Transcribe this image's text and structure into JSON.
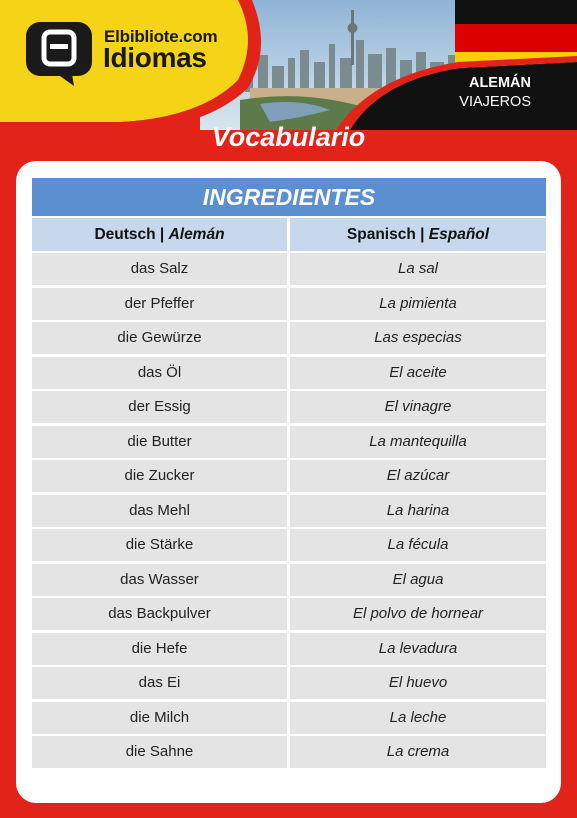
{
  "brand": {
    "site": "Elbibliote.com",
    "name": "Idiomas"
  },
  "course": {
    "language": "ALEMÁN",
    "level": "VIAJEROS"
  },
  "page_title": "Vocabulario",
  "section_title": "INGREDIENTES",
  "columns": {
    "german_name": "Deutsch",
    "german_name_es": "Alemán",
    "spanish_name": "Spanisch",
    "spanish_name_es": "Español",
    "separator": "|"
  },
  "rows": [
    {
      "de": "das Salz",
      "es": "La sal"
    },
    {
      "de": "der Pfeffer",
      "es": "La pimienta"
    },
    {
      "de": "die Gewürze",
      "es": "Las especias"
    },
    {
      "de": "das Öl",
      "es": "El aceite"
    },
    {
      "de": "der Essig",
      "es": "El vinagre"
    },
    {
      "de": "die Butter",
      "es": "La mantequilla"
    },
    {
      "de": "die Zucker",
      "es": "El azúcar"
    },
    {
      "de": "das Mehl",
      "es": "La harina"
    },
    {
      "de": "die Stärke",
      "es": "La fécula"
    },
    {
      "de": "das Wasser",
      "es": "El agua"
    },
    {
      "de": "das Backpulver",
      "es": "El polvo de hornear"
    },
    {
      "de": "die Hefe",
      "es": "La levadura"
    },
    {
      "de": "das Ei",
      "es": "El huevo"
    },
    {
      "de": "die Milch",
      "es": "La leche"
    },
    {
      "de": "die Sahne",
      "es": "La crema"
    }
  ],
  "colors": {
    "background_red": "#e2231a",
    "header_yellow": "#f5d316",
    "section_blue": "#5b8fcf",
    "column_header_blue": "#c7d8ec",
    "cell_gray": "#e4e4e4"
  }
}
